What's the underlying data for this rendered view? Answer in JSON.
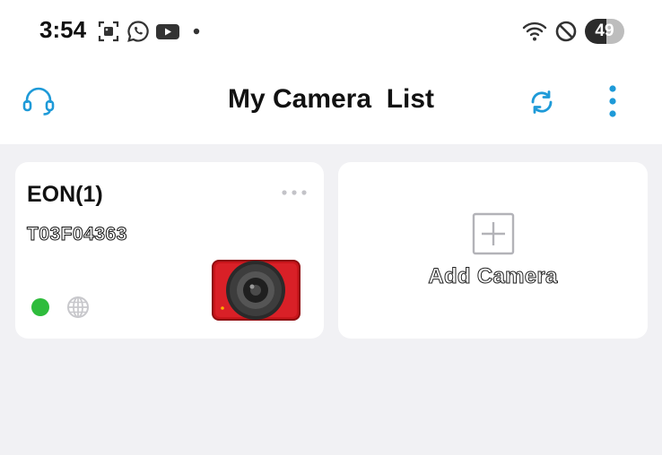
{
  "status_bar": {
    "time": "3:54",
    "notification_icons": [
      "screenshot-icon",
      "whatsapp-icon",
      "youtube-icon",
      "dot-icon"
    ],
    "system_icons": [
      "wifi-icon",
      "do-not-disturb-icon"
    ],
    "battery_level": "49"
  },
  "app_bar": {
    "title": "My Camera  List",
    "support_icon": "headset-icon",
    "refresh_icon": "refresh-icon",
    "menu_icon": "more-vertical-icon",
    "accent_color": "#1e9ad8"
  },
  "cameras": [
    {
      "name": "EON(1)",
      "serial": "T03F04363",
      "online": true,
      "status_color": "#2ebc3c",
      "network_icon": "globe-icon",
      "options_icon": "more-horizontal-icon",
      "thumbnail": "red-camera-thumbnail"
    }
  ],
  "add_card": {
    "label": "Add Camera",
    "icon": "plus-square-icon"
  }
}
